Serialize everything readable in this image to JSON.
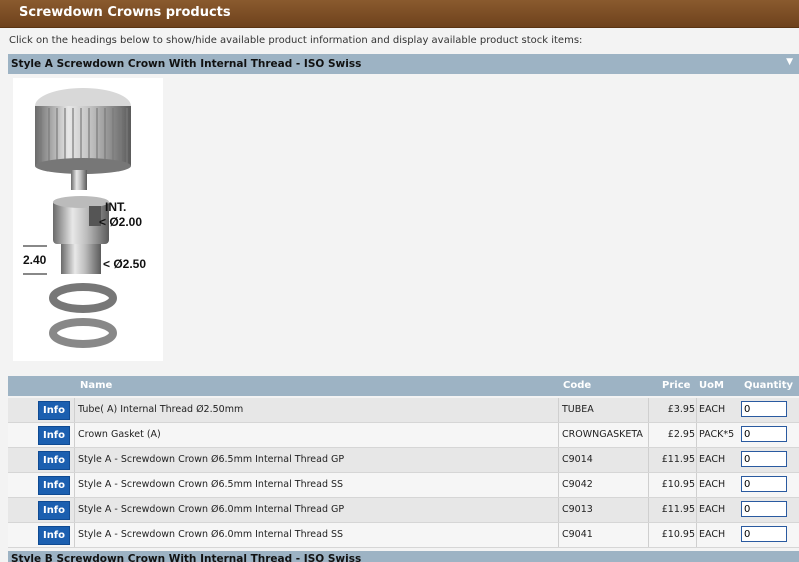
{
  "header": {
    "title": "Screwdown Crowns products"
  },
  "instructions": "Click on the headings below to show/hide available product information and display available product stock items:",
  "section": {
    "title": "Style A Screwdown Crown With Internal Thread - ISO Swiss",
    "toggle_icon": "triangle-down-icon",
    "image_labels": {
      "int": "INT.",
      "dia_inner": "< Ø2.00",
      "height": "2.40",
      "dia_outer": "< Ø2.50"
    }
  },
  "table": {
    "headers": {
      "name": "Name",
      "code": "Code",
      "price": "Price",
      "uom": "UoM",
      "quantity": "Quantity"
    },
    "info_label": "Info",
    "rows": [
      {
        "name": "Tube( A) Internal Thread Ø2.50mm",
        "code": "TUBEA",
        "price": "£3.95",
        "uom": "EACH",
        "quantity": "0"
      },
      {
        "name": "Crown Gasket (A)",
        "code": "CROWNGASKETA",
        "price": "£2.95",
        "uom": "PACK*5",
        "quantity": "0"
      },
      {
        "name": "Style A - Screwdown Crown Ø6.5mm Internal Thread GP",
        "code": "C9014",
        "price": "£11.95",
        "uom": "EACH",
        "quantity": "0"
      },
      {
        "name": "Style A - Screwdown Crown Ø6.5mm Internal Thread SS",
        "code": "C9042",
        "price": "£10.95",
        "uom": "EACH",
        "quantity": "0"
      },
      {
        "name": "Style A - Screwdown Crown Ø6.0mm Internal Thread GP",
        "code": "C9013",
        "price": "£11.95",
        "uom": "EACH",
        "quantity": "0"
      },
      {
        "name": "Style A - Screwdown Crown Ø6.0mm Internal Thread SS",
        "code": "C9041",
        "price": "£10.95",
        "uom": "EACH",
        "quantity": "0"
      }
    ]
  },
  "next_section": {
    "title": "Style B Screwdown Crown With Internal Thread - ISO Swiss"
  },
  "colors": {
    "header_bg": "#7a4a22",
    "section_bg": "#9db3c4",
    "info_btn": "#1b5fb0"
  }
}
